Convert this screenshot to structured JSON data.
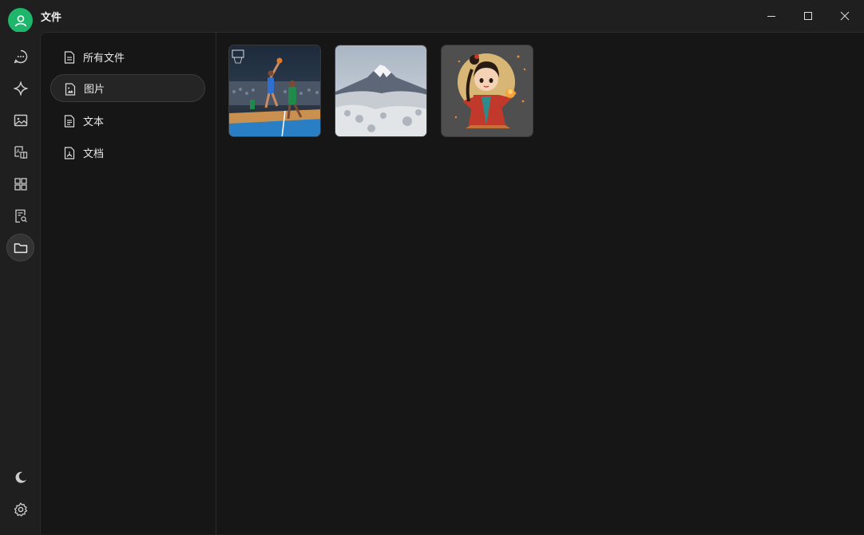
{
  "app": {
    "title": "文件"
  },
  "categories": [
    {
      "label": "所有文件",
      "icon": "file-icon",
      "active": false
    },
    {
      "label": "图片",
      "icon": "image-file-icon",
      "active": true
    },
    {
      "label": "文本",
      "icon": "text-file-icon",
      "active": false
    },
    {
      "label": "文档",
      "icon": "pdf-file-icon",
      "active": false
    }
  ],
  "rail": [
    "chat-icon",
    "sparkle-icon",
    "image-icon",
    "translate-icon",
    "apps-grid-icon",
    "document-search-icon",
    "folder-icon"
  ],
  "rail_bottom": [
    "moon-icon",
    "settings-gear-icon"
  ],
  "thumbnails": [
    {
      "name": "basketball-photo"
    },
    {
      "name": "snowy-mountain-photo"
    },
    {
      "name": "cartoon-girl-photo"
    }
  ],
  "colors": {
    "accent": "#1db66a",
    "background": "#161616",
    "chrome": "#1f1f1f"
  }
}
